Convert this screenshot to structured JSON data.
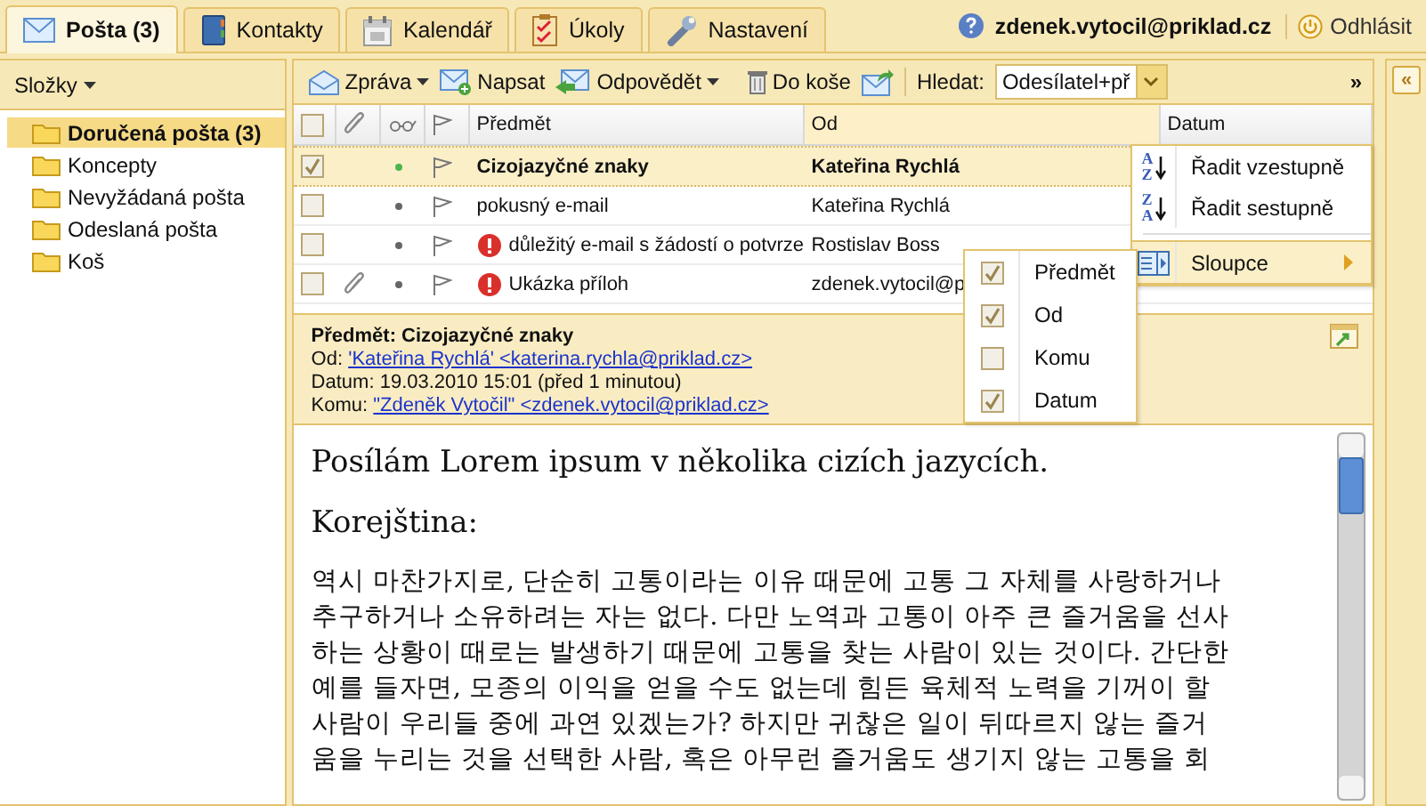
{
  "tabs": [
    {
      "label": "Pošta (3)",
      "kind": "mail",
      "selected": true
    },
    {
      "label": "Kontakty",
      "kind": "contacts",
      "selected": false
    },
    {
      "label": "Kalendář",
      "kind": "calendar",
      "selected": false
    },
    {
      "label": "Úkoly",
      "kind": "tasks",
      "selected": false
    },
    {
      "label": "Nastavení",
      "kind": "settings",
      "selected": false
    }
  ],
  "user": {
    "email": "zdenek.vytocil@priklad.cz",
    "logout": "Odhlásit"
  },
  "sidebar": {
    "title": "Složky",
    "folders": [
      {
        "label": "Doručená pošta (3)",
        "selected": true
      },
      {
        "label": "Koncepty",
        "selected": false
      },
      {
        "label": "Nevyžádaná pošta",
        "selected": false
      },
      {
        "label": "Odeslaná pošta",
        "selected": false
      },
      {
        "label": "Koš",
        "selected": false
      }
    ]
  },
  "toolbar": {
    "buttons": [
      {
        "label": "Zpráva",
        "kind": "message",
        "dropdown": true
      },
      {
        "label": "Napsat",
        "kind": "compose",
        "dropdown": false
      },
      {
        "label": "Odpovědět",
        "kind": "reply",
        "dropdown": true
      },
      {
        "label": "Do koše",
        "kind": "delete",
        "dropdown": false
      },
      {
        "kind": "forward"
      }
    ],
    "search_label": "Hledat:",
    "search_value": "Odesílatel+př",
    "more": "»"
  },
  "grid": {
    "all_checked": false,
    "columns": [
      "Předmět",
      "Od",
      "Datum"
    ],
    "rows": [
      {
        "checked": true,
        "selected": true,
        "unread": true,
        "attachment": false,
        "important": false,
        "subject": "Cizojazyčné znaky",
        "from": "Kateřina Rychlá"
      },
      {
        "checked": false,
        "selected": false,
        "unread": false,
        "attachment": false,
        "important": false,
        "subject": "pokusný e-mail",
        "from": "Kateřina Rychlá"
      },
      {
        "checked": false,
        "selected": false,
        "unread": false,
        "attachment": false,
        "important": true,
        "subject": "důležitý e-mail s žádostí o potvrze",
        "from": "Rostislav Boss"
      },
      {
        "checked": false,
        "selected": false,
        "unread": false,
        "attachment": true,
        "important": true,
        "subject": "Ukázka příloh",
        "from": "zdenek.vytocil@p"
      }
    ]
  },
  "sort_menu": {
    "items": [
      {
        "kind": "sort",
        "icon_top": "A",
        "icon_bottom": "Z",
        "label": "Řadit vzestupně",
        "selected": false
      },
      {
        "kind": "sort",
        "icon_top": "Z",
        "icon_bottom": "A",
        "label": "Řadit sestupně",
        "selected": false
      },
      {
        "kind": "columns",
        "label": "Sloupce",
        "submenu": true,
        "selected": true
      }
    ]
  },
  "columns_menu": {
    "items": [
      {
        "label": "Předmět",
        "checked": true
      },
      {
        "label": "Od",
        "checked": true
      },
      {
        "label": "Komu",
        "checked": false
      },
      {
        "label": "Datum",
        "checked": true
      }
    ]
  },
  "preview": {
    "subject": "Předmět: Cizojazyčné znaky",
    "fields": [
      {
        "label": "Od:",
        "value": "'Kateřina Rychlá' <katerina.rychla@priklad.cz>",
        "link": true
      },
      {
        "label": "Datum:",
        "value": "19.03.2010 15:01 (před 1 minutou)",
        "link": false
      },
      {
        "label": "Komu:",
        "value": "\"Zdeněk Vytočil\" <zdenek.vytocil@priklad.cz>",
        "link": true
      }
    ],
    "body": [
      {
        "kind": "text",
        "text": "Posílám Lorem ipsum v několika cizích jazycích."
      },
      {
        "kind": "text",
        "text": "Korejština:"
      },
      {
        "kind": "korean",
        "text": "역시 마찬가지로, 단순히 고통이라는 이유 때문에 고통 그 자체를 사랑하거나\n추구하거나 소유하려는 자는 없다. 다만 노역과 고통이 아주 큰 즐거움을 선사\n하는 상황이 때로는 발생하기 때문에 고통을 찾는 사람이 있는 것이다. 간단한\n예를 들자면, 모종의 이익을 얻을 수도 없는데 힘든 육체적 노력을 기꺼이 할\n사람이 우리들 중에 과연 있겠는가? 하지만 귀찮은 일이 뒤따르지 않는 즐거\n움을 누리는 것을 선택한 사람, 혹은 아무런 즐거움도 생기지 않는 고통을 회"
      }
    ]
  },
  "collapse": "«"
}
